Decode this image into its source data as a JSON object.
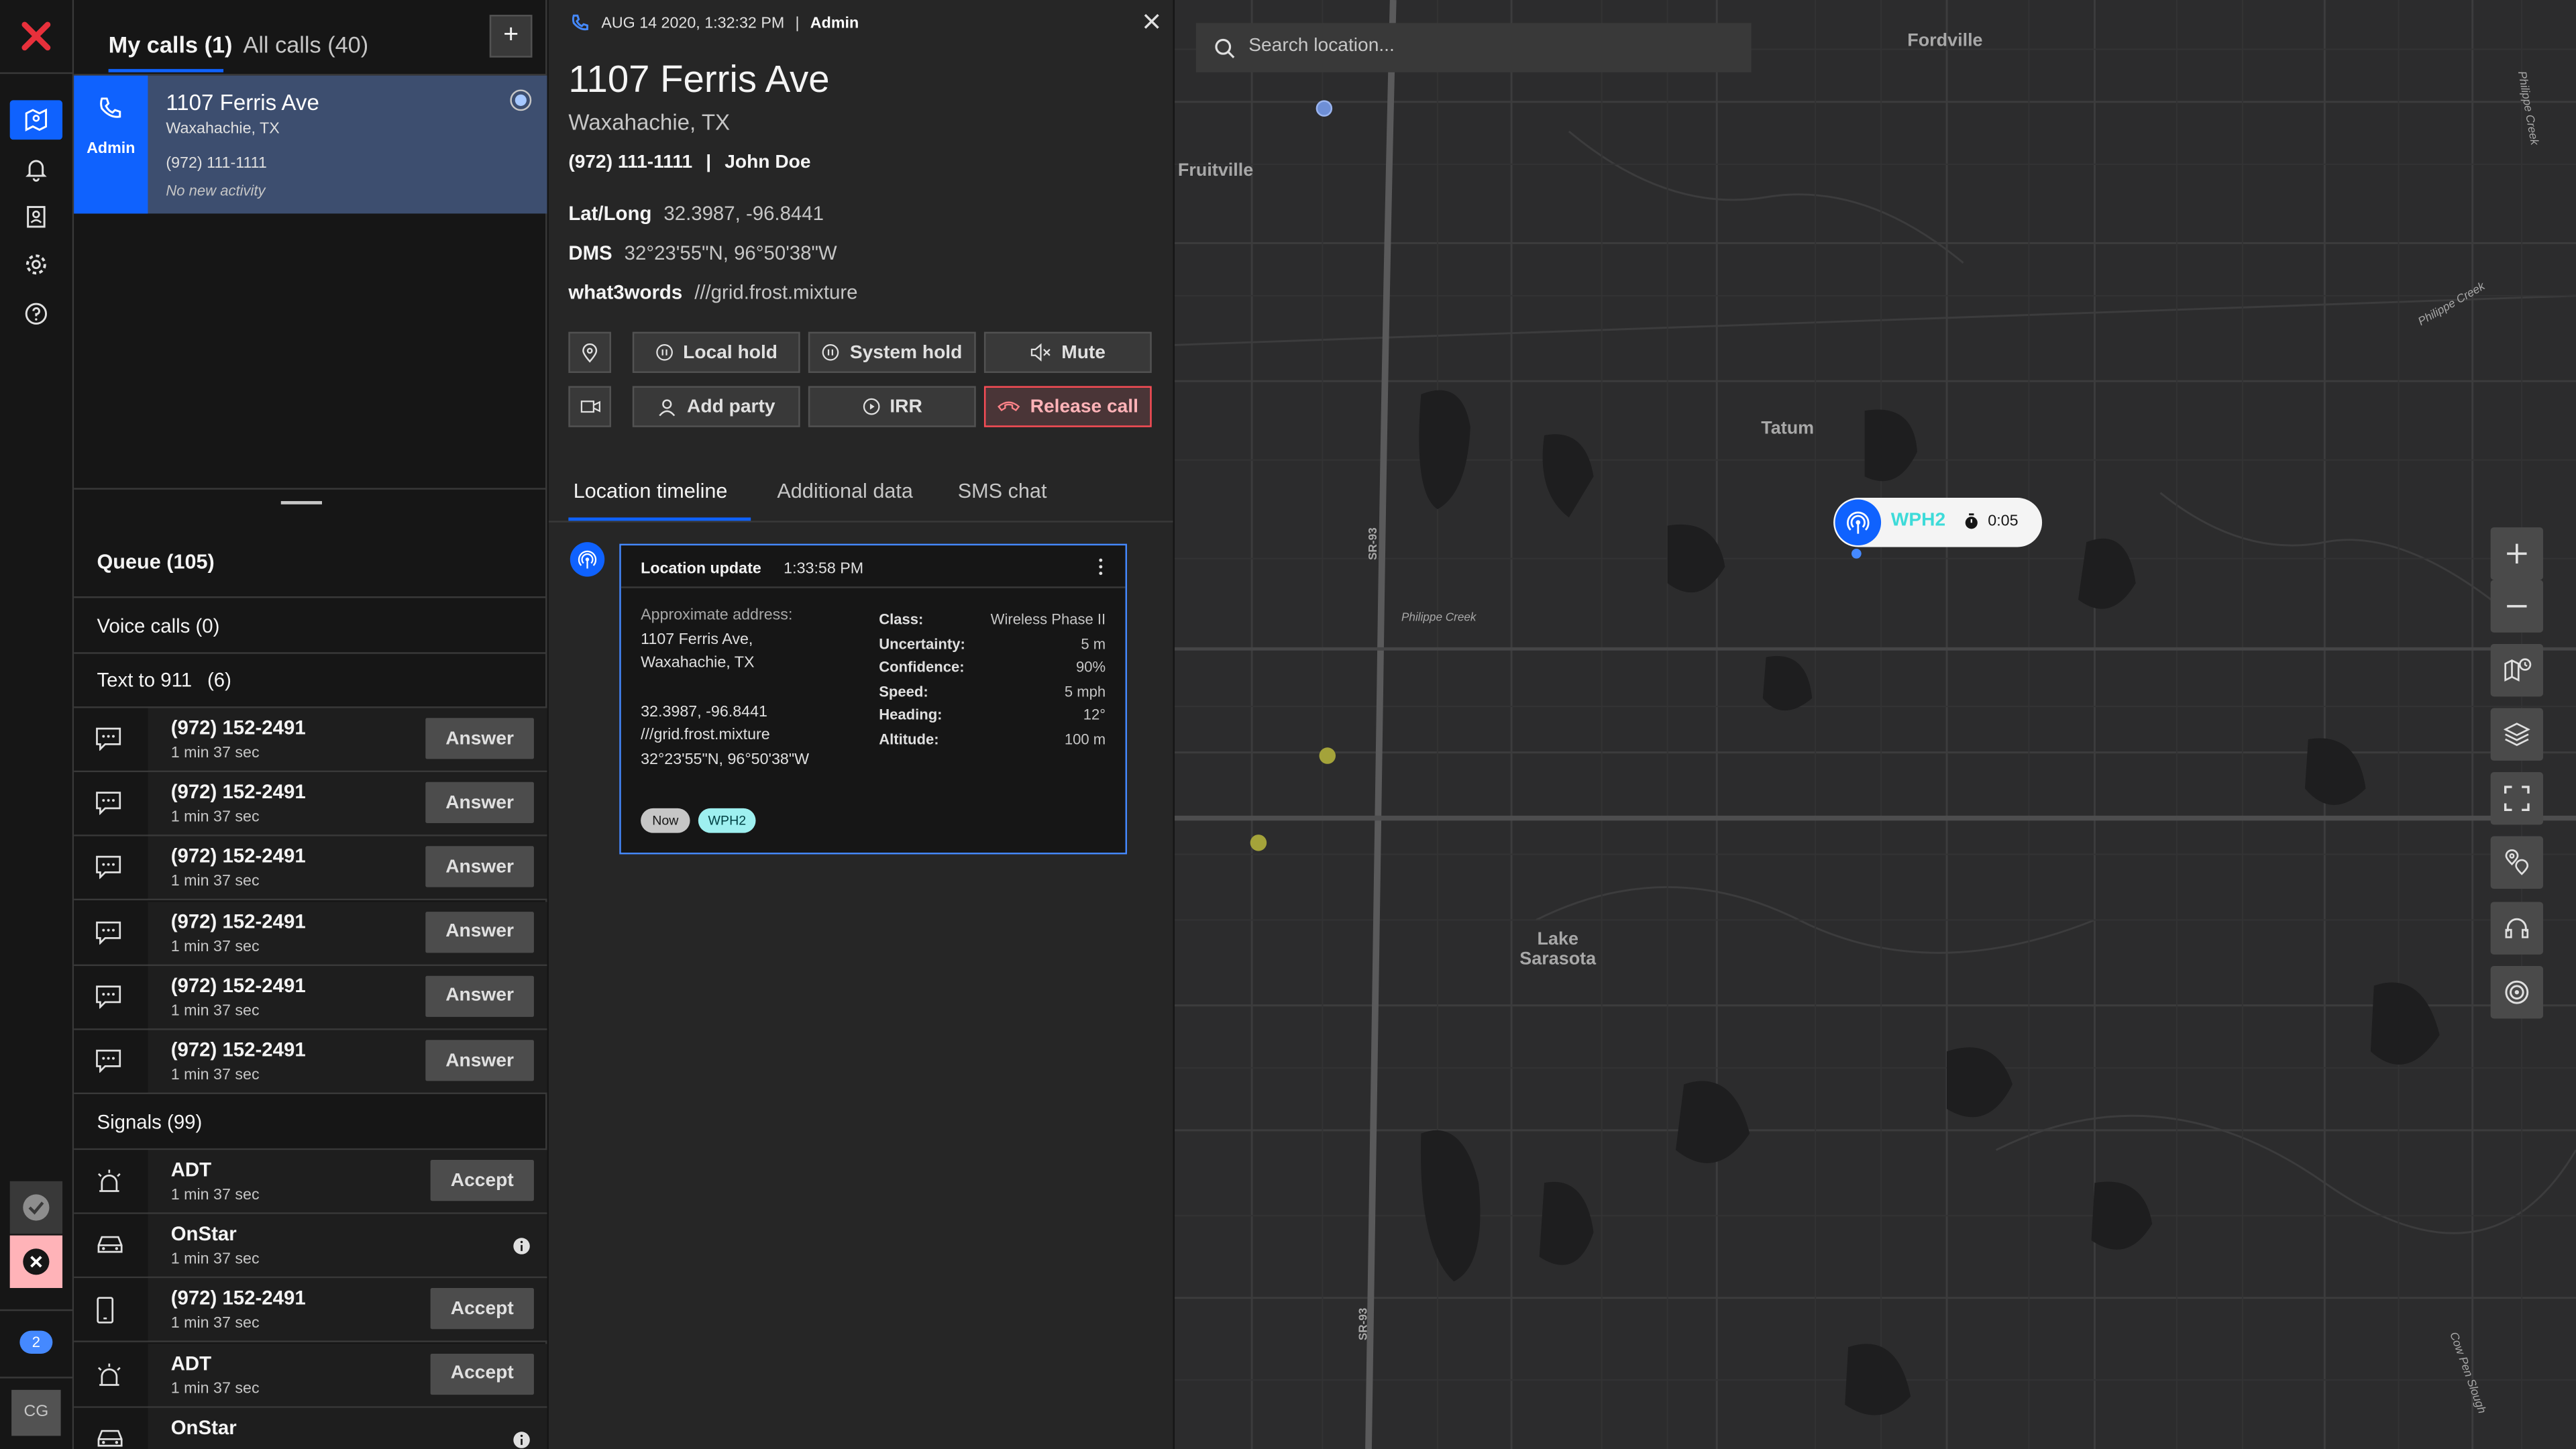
{
  "colors": {
    "accent": "#0f62fe",
    "danger": "#fa4d56",
    "map_bg": "#2c2c2d",
    "card_border": "#4589ff",
    "wph2": "#3ddbd9"
  },
  "rail": {
    "logo": "close-x-logo",
    "icons": [
      "map-icon",
      "notification-icon",
      "contacts-icon",
      "settings-icon",
      "help-icon"
    ],
    "badge": "2",
    "avatar": "CG"
  },
  "calls": {
    "tab_my": "My calls (1)",
    "tab_all": "All calls (40)",
    "add_label": "+",
    "active_call": {
      "user": "Admin",
      "title": "1107 Ferris Ave",
      "city": "Waxahachie, TX",
      "phone": "(972) 111-1111",
      "activity": "No new activity"
    },
    "queue_title": "Queue (105)",
    "voice_calls": "Voice calls (0)",
    "text911_label": "Text to 911",
    "text911_count": "(6)",
    "text_rows": [
      {
        "number": "(972) 152-2491",
        "time": "1 min 37 sec",
        "action": "Answer"
      },
      {
        "number": "(972) 152-2491",
        "time": "1 min 37 sec",
        "action": "Answer"
      },
      {
        "number": "(972) 152-2491",
        "time": "1 min 37 sec",
        "action": "Answer"
      },
      {
        "number": "(972) 152-2491",
        "time": "1 min 37 sec",
        "action": "Answer"
      },
      {
        "number": "(972) 152-2491",
        "time": "1 min 37 sec",
        "action": "Answer"
      },
      {
        "number": "(972) 152-2491",
        "time": "1 min 37 sec",
        "action": "Answer"
      }
    ],
    "signals_title": "Signals (99)",
    "signal_rows": [
      {
        "name": "ADT",
        "time": "1 min 37 sec",
        "action": "Accept",
        "icon": "alarm-icon"
      },
      {
        "name": "OnStar",
        "time": "1 min 37 sec",
        "action": "",
        "icon": "car-icon"
      },
      {
        "name": "(972) 152-2491",
        "time": "1 min 37 sec",
        "action": "Accept",
        "icon": "mobile-icon"
      },
      {
        "name": "ADT",
        "time": "1 min 37 sec",
        "action": "Accept",
        "icon": "alarm-icon"
      },
      {
        "name": "OnStar",
        "time": "",
        "action": "",
        "icon": "car-icon"
      }
    ]
  },
  "detail": {
    "meta_date": "AUG 14 2020, 1:32:32 PM",
    "meta_sep": "|",
    "meta_user": "Admin",
    "title": "1107 Ferris Ave",
    "city": "Waxahachie, TX",
    "phone": "(972) 111-1111",
    "phone_sep": "|",
    "caller": "John Doe",
    "latlong_label": "Lat/Long",
    "latlong": "32.3987, -96.8441",
    "dms_label": "DMS",
    "dms": "32°23'55\"N, 96°50'38\"W",
    "w3w_label": "what3words",
    "w3w": "///grid.frost.mixture",
    "actions": {
      "local_hold": "Local hold",
      "system_hold": "System hold",
      "mute": "Mute",
      "add_party": "Add party",
      "irr": "IRR",
      "release": "Release call"
    },
    "tabs": [
      "Location timeline",
      "Additional data",
      "SMS chat"
    ],
    "card": {
      "title": "Location update",
      "time": "1:33:58 PM",
      "addr_label": "Approximate address:",
      "addr_line1": "1107 Ferris Ave,",
      "addr_line2": "Waxahachie, TX",
      "coords": "32.3987, -96.8441",
      "w3w": "///grid.frost.mixture",
      "dms": "32°23'55\"N, 96°50'38\"W",
      "fields": [
        {
          "k": "Class:",
          "v": "Wireless Phase II"
        },
        {
          "k": "Uncertainty:",
          "v": "5 m"
        },
        {
          "k": "Confidence:",
          "v": "90%"
        },
        {
          "k": "Speed:",
          "v": "5 mph"
        },
        {
          "k": "Heading:",
          "v": "12°"
        },
        {
          "k": "Altitude:",
          "v": "100 m"
        }
      ],
      "tag_now": "Now",
      "tag_wph2": "WPH2"
    }
  },
  "map": {
    "search_placeholder": "Search location...",
    "labels": {
      "fordville": "Fordville",
      "fruitville": "Fruitville",
      "tatum": "Tatum",
      "lake_sarasota_1": "Lake",
      "lake_sarasota_2": "Sarasota",
      "sr93_a": "SR-93",
      "sr93_b": "SR-93",
      "philippe_creek": "Philippe Creek",
      "philippe_creek_2": "Philippe Creek",
      "cow_pen_slough": "Cow Pen Slough",
      "philippe_creek_3": "Philippe Creek"
    },
    "marker": {
      "label": "WPH2",
      "timer": "0:05"
    },
    "controls": [
      "zoom-in-icon",
      "zoom-out-icon",
      "map-legend-icon",
      "layers-icon",
      "fullscreen-icon",
      "location-pins-icon",
      "headset-icon",
      "target-icon"
    ]
  }
}
